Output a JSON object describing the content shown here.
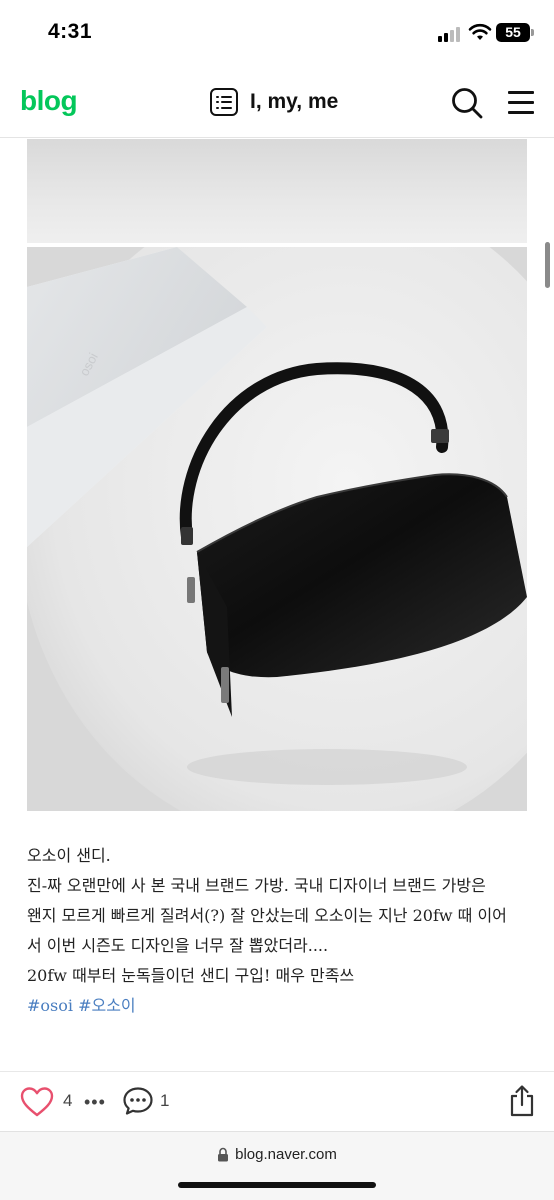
{
  "status_bar": {
    "time": "4:31",
    "battery_level": "55",
    "icons": [
      "signal-icon",
      "wifi-icon",
      "battery-icon"
    ]
  },
  "header": {
    "logo": "blog",
    "logo_color": "#03c75a",
    "title": "I, my, me",
    "icons": [
      "list-icon",
      "search-icon",
      "menu-icon"
    ]
  },
  "post": {
    "lines": [
      "오소이 샌디.",
      "진-짜 오랜만에 사 본 국내 브랜드 가방. 국내 디자이너 브랜드 가방은",
      "왠지 모르게 빠르게 질려서(?) 잘 안샀는데 오소이는 지난 20fw 때 이어",
      "서 이번 시즌도 디자인을 너무 잘 뽑았더라....",
      "20fw 때부터 눈독들이던 샌디 구입! 매우 만족쓰"
    ],
    "hashtags": "#osoi #오소이",
    "hashtag_color": "#4a7ec0",
    "photo_box_text": "osoi"
  },
  "reactions": {
    "like_count": "4",
    "more": "•••",
    "comment_count": "1",
    "heart_color": "#e8506e"
  },
  "browser": {
    "url": "blog.naver.com"
  }
}
